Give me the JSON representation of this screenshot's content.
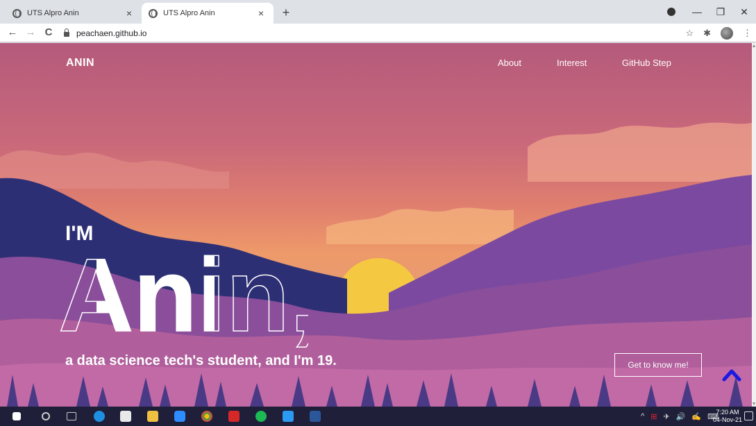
{
  "browser": {
    "tabs": [
      {
        "title": "UTS Alpro Anin",
        "active": false
      },
      {
        "title": "UTS Alpro Anin",
        "active": true
      }
    ],
    "new_tab_icon": "+",
    "url": "peachaen.github.io",
    "window_controls": [
      "—",
      "❐",
      "✕"
    ],
    "nav_icons": {
      "back": "←",
      "forward": "→",
      "reload": "C"
    },
    "toolbar_icons": {
      "bookmark": "☆",
      "extensions": "✱",
      "menu": "⋮"
    }
  },
  "site": {
    "brand": "ANIN",
    "nav": [
      "About",
      "Interest",
      "GitHub Step"
    ],
    "hero": {
      "greeting": "I'M",
      "name": "Anin,",
      "subtitle": "a data science tech's student, and I'm 19.",
      "cta": "Get to know me!"
    },
    "colors": {
      "sky_top": "#b55a7c",
      "sky_bottom": "#ee9a6a",
      "sun": "#f5c842",
      "mountain_dark": "#2a2a6a",
      "accent_arrow": "#1a1ae0"
    }
  },
  "taskbar": {
    "time": "7:20 AM",
    "date": "04-Nov-21",
    "tray_icons": [
      "^",
      "⊞",
      "✈",
      "🔊",
      "✍",
      "⌨"
    ]
  }
}
